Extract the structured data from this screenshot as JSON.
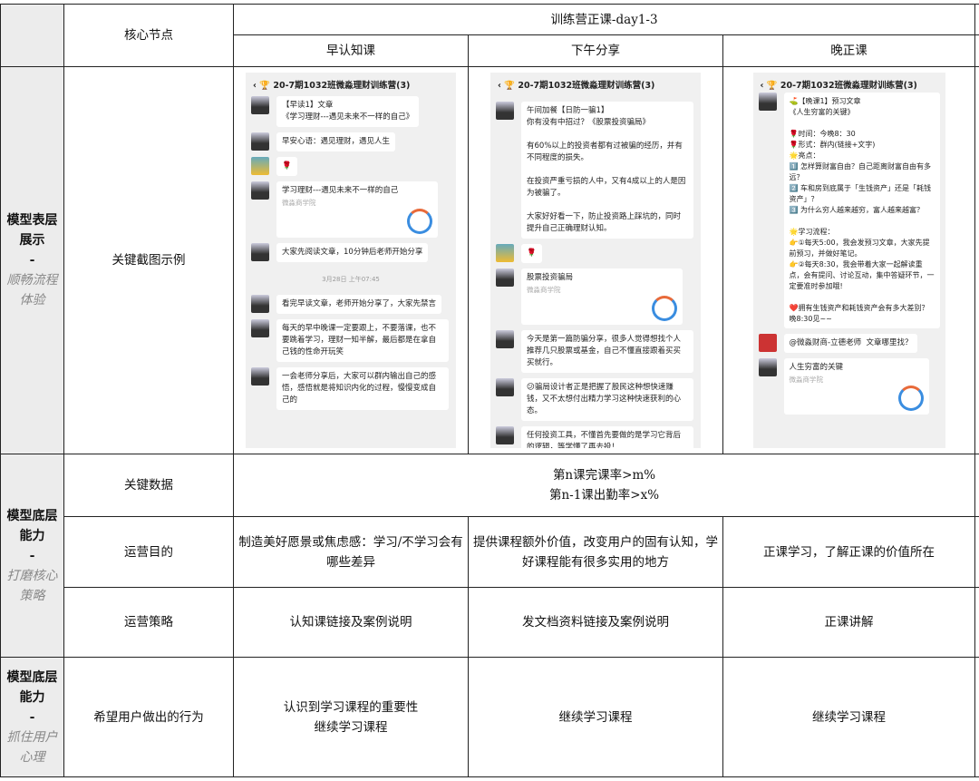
{
  "header": {
    "core_node": "核心节点",
    "group_title": "训练营正课-day1-3",
    "columns": [
      "早认知课",
      "下午分享",
      "晚正课"
    ]
  },
  "stages": [
    {
      "title": "模型表层展示",
      "dash": "-",
      "subtitle": "顺畅流程体验"
    },
    {
      "title": "模型底层能力",
      "dash": "-",
      "subtitle": "打磨核心策略"
    },
    {
      "title": "模型底层能力",
      "dash": "-",
      "subtitle": "抓住用户心理"
    }
  ],
  "rows": {
    "screenshots_label": "关键截图示例",
    "key_data_label": "关键数据",
    "key_data_lines": [
      "第n课完课率>m%",
      "第n-1课出勤率>x%"
    ],
    "purpose_label": "运营目的",
    "purpose": [
      "制造美好愿景或焦虑感：学习/不学习会有哪些差异",
      "提供课程额外价值，改变用户的固有认知，学好课程能有很多实用的地方",
      "正课学习，了解正课的价值所在"
    ],
    "strategy_label": "运营策略",
    "strategy": [
      "认知课链接及案例说明",
      "发文档资料链接及案例说明",
      "正课讲解"
    ],
    "behavior_label": "希望用户做出的行为",
    "behavior": [
      [
        "认识到学习课程的重要性",
        "继续学习课程"
      ],
      [
        "继续学习课程"
      ],
      [
        "继续学习课程"
      ]
    ]
  },
  "chat": {
    "group_name": "20-7期1032班微淼理财训练营(3)",
    "card_source": "微淼商学院",
    "morning": {
      "m1": "【早读1】文章\n《学习理财---遇见未来不一样的自己》",
      "m2": "早安心语：遇见理财，遇见人生",
      "m3": "🌹",
      "card": "学习理财---遇见未来不一样的自己",
      "m4": "大家先阅读文章，10分钟后老师开始分享",
      "ts": "3月28日 上午07:45",
      "m5": "看完早读文章，老师开始分享了，大家先禁言",
      "m6": "每天的早中晚课一定要跟上，不要落课，也不要跳着学习，理财一知半解，最后都是在拿自己钱的性命开玩笑",
      "m7": "一会老师分享后，大家可以群内输出自己的感悟，感悟就是将知识内化的过程，慢慢变成自己的"
    },
    "afternoon": {
      "m1": "午间加餐【日防一骗1】\n你有没有中招过？《股票投资骗局》\n\n有60%以上的投资者都有过被骗的经历，并有不同程度的损失。\n\n在投资严重亏损的人中，又有4成以上的人是因为被骗了。\n\n大家好好看一下，防止投资路上踩坑的，同时提升自己正确理财认知。",
      "m2": "🌹",
      "card": "股票投资骗局",
      "m3": "今天是第一篇防骗分享，很多人觉得想找个人推荐几只股票或基金，自己不懂直接跟着买买买就行。",
      "m4": "😕骗局设计者正是把握了股民这种想快速赚钱，又不太想付出精力学习这种快速获利的心态。",
      "m5": "任何投资工具，不懂首先要做的是学习它背后的逻辑，等学懂了再去投！"
    },
    "evening": {
      "m1": "⛳【晚课1】预习文章\n《人生穷富的关键》\n\n🌹时间：今晚8：30\n🌹形式：群内(链接+文字)\n🌟亮点：\n1️⃣ 怎样算财富自由？自己距离财富自由有多远？\n2️⃣ 车和房到底属于「生钱资产」还是「耗钱资产」？\n3️⃣ 为什么穷人越来越穷，富人越来越富？\n\n🌟学习流程：\n👉①每天5:00，我会发预习文章，大家先提前预习，并做好笔记。\n👉②每天8:30，我会带着大家一起解读重点，会有提问、讨论互动，集中答疑环节，一定要准时参加哦!\n\n❤️拥有生钱资产和耗钱资产会有多大差别？ 晚8:30见~~",
      "m2": "@微淼财商-立德老师  文章哪里找？",
      "card": "人生穷富的关键"
    }
  }
}
